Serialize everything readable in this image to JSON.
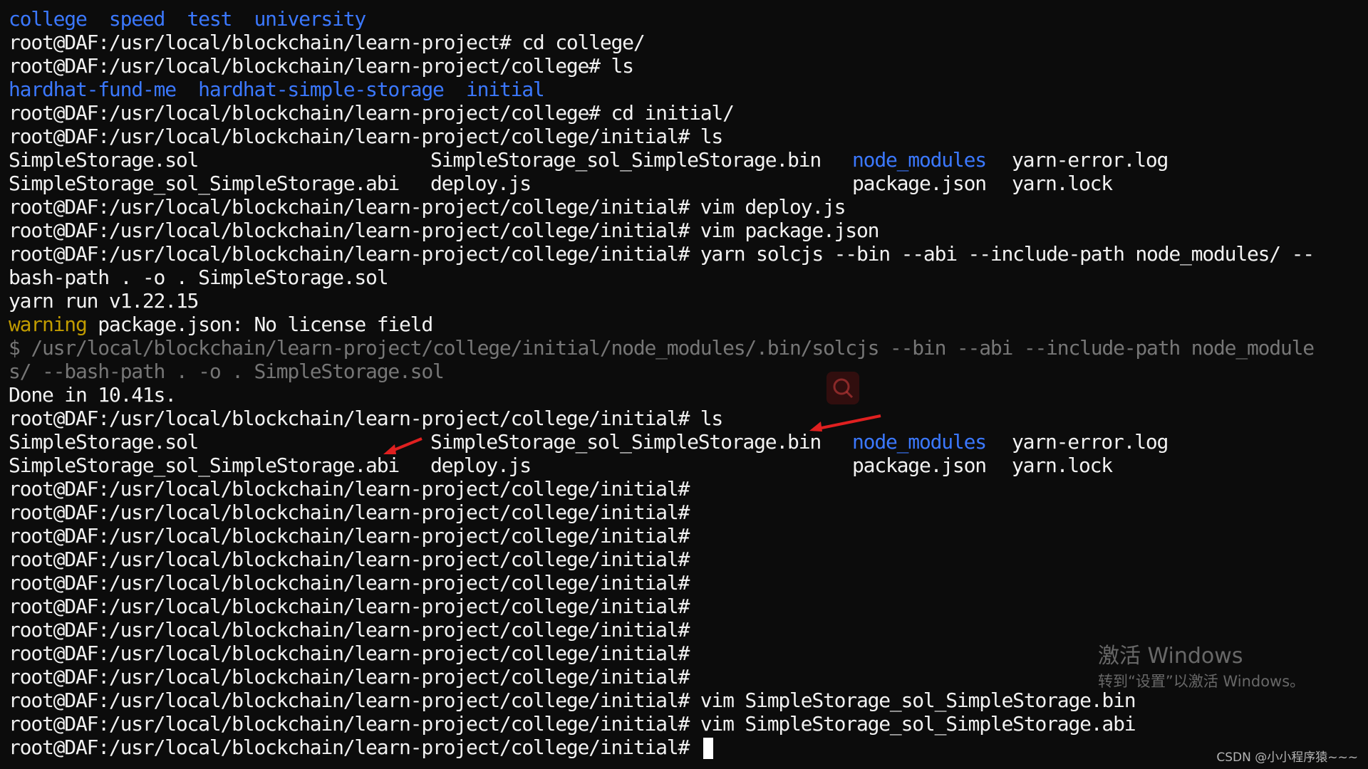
{
  "terminal": {
    "lines": [
      {
        "segments": [
          {
            "text": "college  speed  test  university",
            "color": "blue"
          }
        ]
      },
      {
        "segments": [
          {
            "text": "root@DAF:/usr/local/blockchain/learn-project# cd college/",
            "color": "white"
          }
        ]
      },
      {
        "segments": [
          {
            "text": "root@DAF:/usr/local/blockchain/learn-project/college# ls",
            "color": "white"
          }
        ]
      },
      {
        "segments": [
          {
            "text": "hardhat-fund-me  hardhat-simple-storage  initial",
            "color": "blue"
          }
        ]
      },
      {
        "segments": [
          {
            "text": "root@DAF:/usr/local/blockchain/learn-project/college# cd initial/",
            "color": "white"
          }
        ]
      },
      {
        "segments": [
          {
            "text": "root@DAF:/usr/local/blockchain/learn-project/college/initial# ls",
            "color": "white"
          }
        ]
      },
      {
        "listing": [
          "SimpleStorage.sol",
          "SimpleStorage_sol_SimpleStorage.bin",
          "node_modules",
          "yarn-error.log"
        ]
      },
      {
        "listing": [
          "SimpleStorage_sol_SimpleStorage.abi",
          "deploy.js",
          "package.json",
          "yarn.lock"
        ]
      },
      {
        "segments": [
          {
            "text": "root@DAF:/usr/local/blockchain/learn-project/college/initial# vim deploy.js",
            "color": "white"
          }
        ]
      },
      {
        "segments": [
          {
            "text": "root@DAF:/usr/local/blockchain/learn-project/college/initial# vim package.json",
            "color": "white"
          }
        ]
      },
      {
        "segments": [
          {
            "text": "root@DAF:/usr/local/blockchain/learn-project/college/initial# yarn solcjs --bin --abi --include-path node_modules/ --",
            "color": "white"
          }
        ]
      },
      {
        "segments": [
          {
            "text": "bash-path . -o . SimpleStorage.sol",
            "color": "white"
          }
        ]
      },
      {
        "segments": [
          {
            "text": "yarn run v1.22.15",
            "color": "white"
          }
        ]
      },
      {
        "segments": [
          {
            "text": "warning",
            "color": "yellow"
          },
          {
            "text": " package.json: No license field",
            "color": "white"
          }
        ]
      },
      {
        "segments": [
          {
            "text": "$ /usr/local/blockchain/learn-project/college/initial/node_modules/.bin/solcjs --bin --abi --include-path node_module",
            "color": "gray"
          }
        ]
      },
      {
        "segments": [
          {
            "text": "s/ --bash-path . -o . SimpleStorage.sol",
            "color": "gray"
          }
        ]
      },
      {
        "segments": [
          {
            "text": "Done in 10.41s.",
            "color": "white"
          }
        ]
      },
      {
        "segments": [
          {
            "text": "root@DAF:/usr/local/blockchain/learn-project/college/initial# ls",
            "color": "white"
          }
        ]
      },
      {
        "listing": [
          "SimpleStorage.sol",
          "SimpleStorage_sol_SimpleStorage.bin",
          "node_modules",
          "yarn-error.log"
        ]
      },
      {
        "listing": [
          "SimpleStorage_sol_SimpleStorage.abi",
          "deploy.js",
          "package.json",
          "yarn.lock"
        ]
      },
      {
        "segments": [
          {
            "text": "root@DAF:/usr/local/blockchain/learn-project/college/initial#",
            "color": "white"
          }
        ]
      },
      {
        "segments": [
          {
            "text": "root@DAF:/usr/local/blockchain/learn-project/college/initial#",
            "color": "white"
          }
        ]
      },
      {
        "segments": [
          {
            "text": "root@DAF:/usr/local/blockchain/learn-project/college/initial#",
            "color": "white"
          }
        ]
      },
      {
        "segments": [
          {
            "text": "root@DAF:/usr/local/blockchain/learn-project/college/initial#",
            "color": "white"
          }
        ]
      },
      {
        "segments": [
          {
            "text": "root@DAF:/usr/local/blockchain/learn-project/college/initial#",
            "color": "white"
          }
        ]
      },
      {
        "segments": [
          {
            "text": "root@DAF:/usr/local/blockchain/learn-project/college/initial#",
            "color": "white"
          }
        ]
      },
      {
        "segments": [
          {
            "text": "root@DAF:/usr/local/blockchain/learn-project/college/initial#",
            "color": "white"
          }
        ]
      },
      {
        "segments": [
          {
            "text": "root@DAF:/usr/local/blockchain/learn-project/college/initial#",
            "color": "white"
          }
        ]
      },
      {
        "segments": [
          {
            "text": "root@DAF:/usr/local/blockchain/learn-project/college/initial#",
            "color": "white"
          }
        ]
      },
      {
        "segments": [
          {
            "text": "root@DAF:/usr/local/blockchain/learn-project/college/initial# vim SimpleStorage_sol_SimpleStorage.bin",
            "color": "white"
          }
        ]
      },
      {
        "segments": [
          {
            "text": "root@DAF:/usr/local/blockchain/learn-project/college/initial# vim SimpleStorage_sol_SimpleStorage.abi",
            "color": "white"
          }
        ]
      },
      {
        "segments": [
          {
            "text": "root@DAF:/usr/local/blockchain/learn-project/college/initial# ",
            "color": "white"
          }
        ],
        "cursor": true
      }
    ],
    "listing_dir_entry": "node_modules"
  },
  "colors": {
    "background": "#0c0c0c",
    "white": "#f2f2f2",
    "blue": "#3b78ff",
    "yellow": "#c19c00",
    "gray": "#767676",
    "annotation_arrow": "#e02020"
  },
  "overlay": {
    "search_icon": "search-icon",
    "watermark_title": "激活 Windows",
    "watermark_subtitle": "转到“设置”以激活 Windows。",
    "credit": "CSDN @小小程序猿~~~"
  }
}
